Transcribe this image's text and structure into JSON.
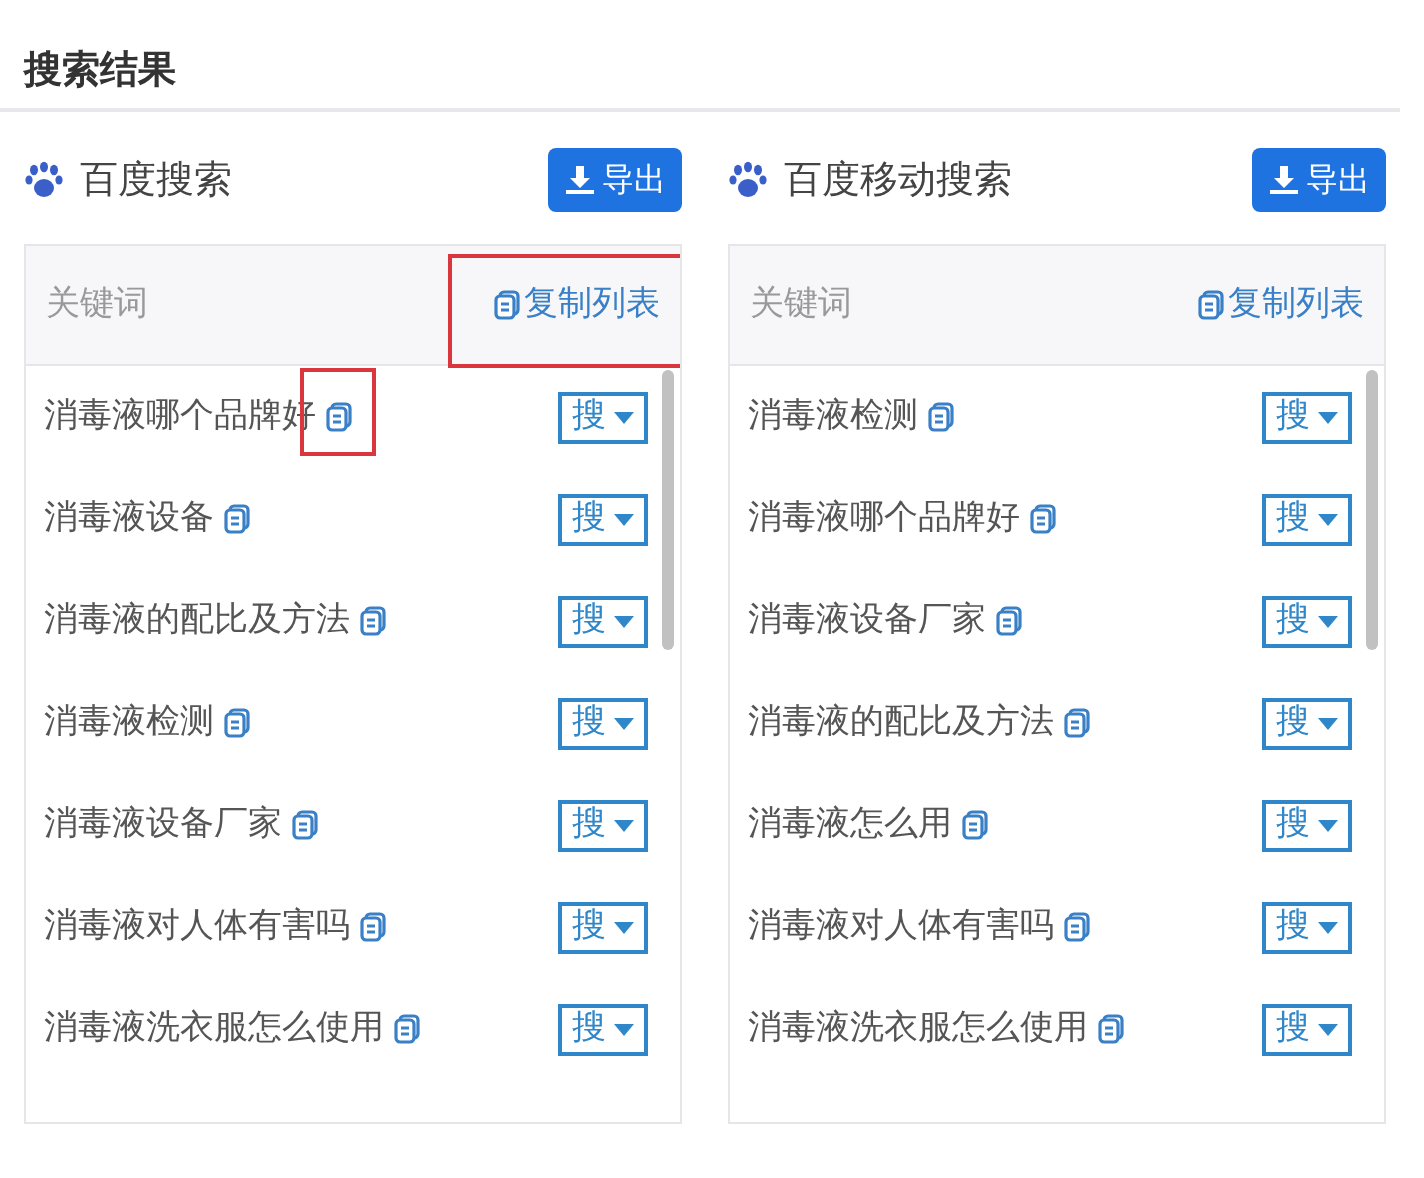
{
  "title": "搜索结果",
  "panels": [
    {
      "name": "百度搜索",
      "export_button": "导出",
      "column_header": "关键词",
      "copy_list": {
        "label": "复制列表",
        "highlighted": true
      },
      "rows": [
        {
          "keyword": "消毒液哪个品牌好",
          "button": "搜",
          "highlighted": true
        },
        {
          "keyword": "消毒液设备",
          "button": "搜",
          "highlighted": false
        },
        {
          "keyword": "消毒液的配比及方法",
          "button": "搜",
          "highlighted": false
        },
        {
          "keyword": "消毒液检测",
          "button": "搜",
          "highlighted": false
        },
        {
          "keyword": "消毒液设备厂家",
          "button": "搜",
          "highlighted": false
        },
        {
          "keyword": "消毒液对人体有害吗",
          "button": "搜",
          "highlighted": false
        },
        {
          "keyword": "消毒液洗衣服怎么使用",
          "button": "搜",
          "highlighted": false
        }
      ]
    },
    {
      "name": "百度移动搜索",
      "export_button": "导出",
      "column_header": "关键词",
      "copy_list": {
        "label": "复制列表",
        "highlighted": false
      },
      "rows": [
        {
          "keyword": "消毒液检测",
          "button": "搜",
          "highlighted": false
        },
        {
          "keyword": "消毒液哪个品牌好",
          "button": "搜",
          "highlighted": false
        },
        {
          "keyword": "消毒液设备厂家",
          "button": "搜",
          "highlighted": false
        },
        {
          "keyword": "消毒液的配比及方法",
          "button": "搜",
          "highlighted": false
        },
        {
          "keyword": "消毒液怎么用",
          "button": "搜",
          "highlighted": false
        },
        {
          "keyword": "消毒液对人体有害吗",
          "button": "搜",
          "highlighted": false
        },
        {
          "keyword": "消毒液洗衣服怎么使用",
          "button": "搜",
          "highlighted": false
        }
      ]
    }
  ]
}
